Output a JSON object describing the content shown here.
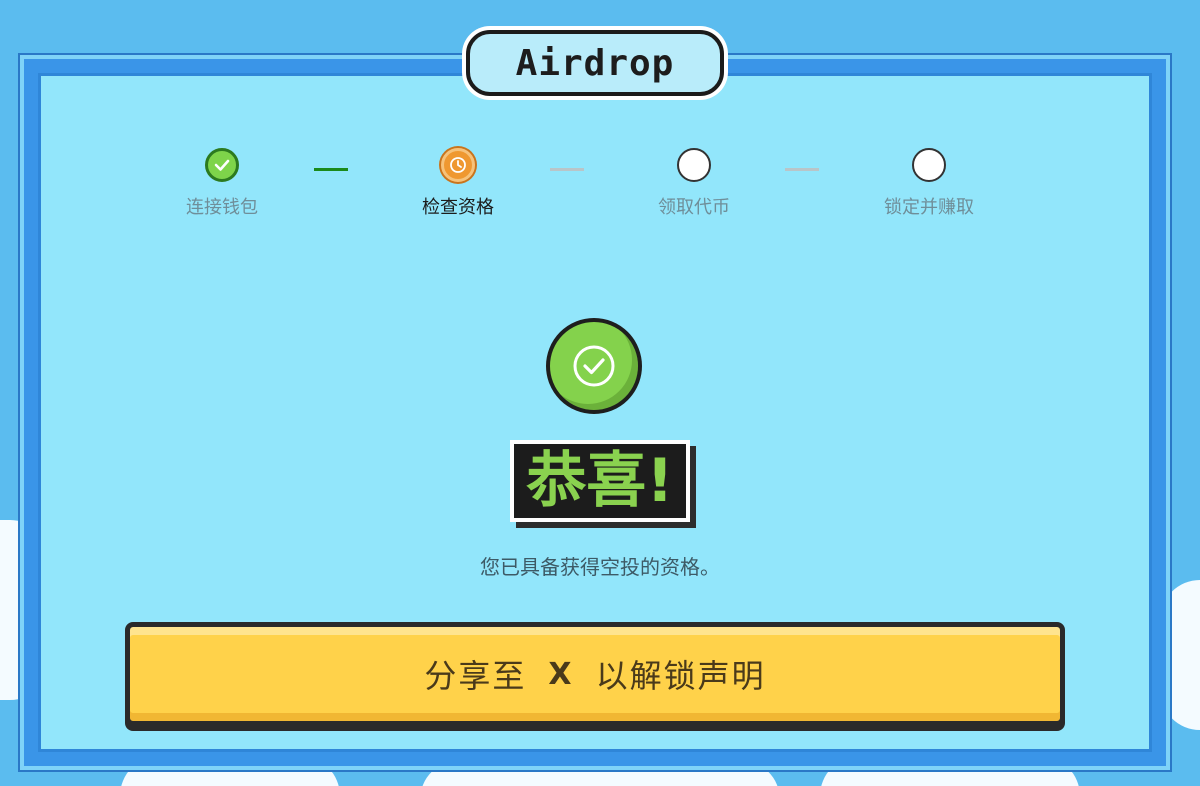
{
  "header": {
    "title": "Airdrop"
  },
  "steps": [
    {
      "label": "连接钱包",
      "status": "completed",
      "icon": "check-icon"
    },
    {
      "label": "检查资格",
      "status": "active",
      "icon": "clock-icon"
    },
    {
      "label": "领取代币",
      "status": "pending",
      "icon": "empty-circle-icon"
    },
    {
      "label": "锁定并赚取",
      "status": "pending",
      "icon": "empty-circle-icon"
    }
  ],
  "result": {
    "icon": "check-circle-icon",
    "headline": "恭喜!",
    "message": "您已具备获得空投的资格。"
  },
  "share_button": {
    "prefix": "分享至",
    "icon": "x-logo-icon",
    "icon_glyph": "X",
    "suffix": "以解锁声明"
  },
  "colors": {
    "frame_blue": "#3a95e8",
    "panel_cyan": "#92e6fb",
    "success_green": "#84d24c",
    "active_orange": "#ef9830",
    "button_yellow": "#ffd24a"
  }
}
